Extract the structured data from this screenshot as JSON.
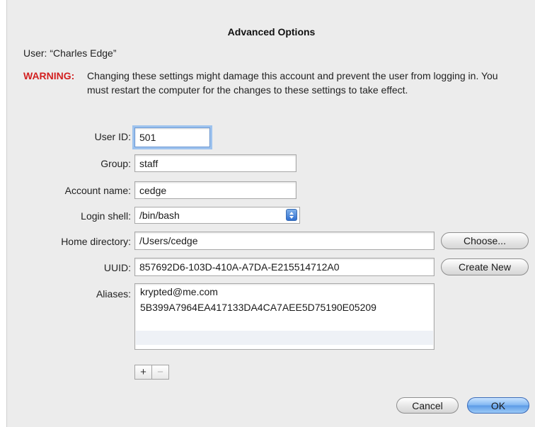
{
  "dialog": {
    "title": "Advanced Options",
    "user_line": "User: “Charles Edge”",
    "warning_label": "WARNING:",
    "warning_text": "Changing these settings might damage this account and prevent the user from logging in. You must restart the computer for the changes to these settings to take effect."
  },
  "form": {
    "user_id": {
      "label": "User ID:",
      "value": "501"
    },
    "group": {
      "label": "Group:",
      "value": "staff"
    },
    "account_name": {
      "label": "Account name:",
      "value": "cedge"
    },
    "login_shell": {
      "label": "Login shell:",
      "value": "/bin/bash"
    },
    "home_directory": {
      "label": "Home directory:",
      "value": "/Users/cedge",
      "button": "Choose..."
    },
    "uuid": {
      "label": "UUID:",
      "value": "857692D6-103D-410A-A7DA-E215514712A0",
      "button": "Create New"
    },
    "aliases": {
      "label": "Aliases:",
      "items": [
        "krypted@me.com",
        "5B399A7964EA417133DA4CA7AEE5D75190E05209"
      ],
      "add_label": "+",
      "remove_label": "−"
    }
  },
  "footer": {
    "cancel": "Cancel",
    "ok": "OK"
  },
  "colors": {
    "warning": "#d21f1f",
    "default_button": "#5b9ae6",
    "focus_ring": "#9ec3ee"
  },
  "icons": {
    "select_arrow": "popup-arrows-icon"
  }
}
